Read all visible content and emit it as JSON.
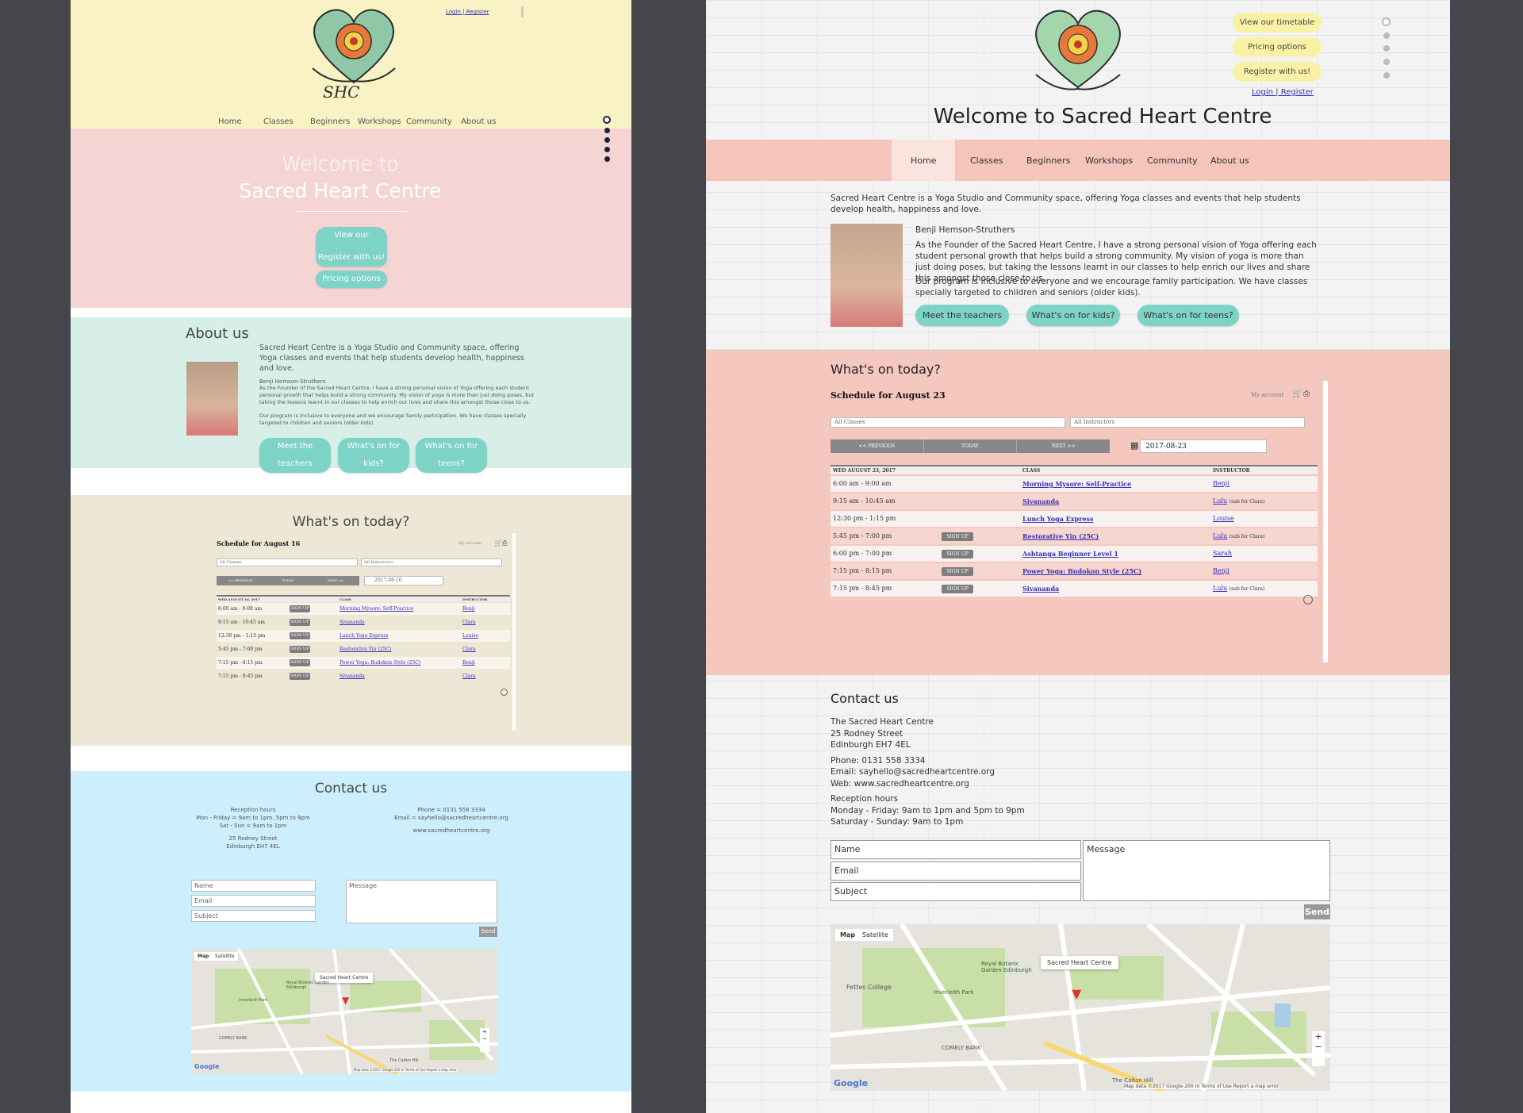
{
  "left": {
    "auth_link": "Login | Register",
    "logo_text": "SHC",
    "nav": [
      "Home",
      "Classes",
      "Beginners",
      "Workshops",
      "Community",
      "About us"
    ],
    "hero": {
      "title_line1": "Welcome to",
      "title_line2": "Sacred Heart Centre",
      "buttons": [
        "View our timetable",
        "Register with us!",
        "Pricing options"
      ]
    },
    "about": {
      "heading": "About us",
      "intro": "Sacred Heart Centre is a Yoga Studio and Community space, offering Yoga classes and events that help students develop health, happiness and love.",
      "name": "Benji Hemson-Struthers",
      "bio1": "As the Founder of the Sacred Heart Centre, I have a strong personal vision of Yoga offering each student personal growth that helps build a strong community. My vision of yoga is more than just doing poses, but taking the lessons learnt in our classes to help enrich our lives and share this amongst those close to us.",
      "bio2": "Our program is inclusive to everyone and we encourage family participation. We have classes specially targeted to children and seniors (older kids).",
      "buttons": [
        "Meet the teachers",
        "What's on for kids?",
        "What's on for teens?"
      ]
    },
    "today": {
      "heading": "What's on today?",
      "schedule_label": "Schedule for",
      "schedule_date": "August 16",
      "my_account": "My account",
      "filter_classes": "All Classes",
      "filter_instructors": "All Instructors",
      "prev": "<< PREVIOUS",
      "today": "TODAY",
      "next": "NEXT >>",
      "date_value": "2017-08-16",
      "col_day": "WED AUGUST 16, 2017",
      "col_class": "CLASS",
      "col_instructor": "INSTRUCTOR",
      "signup": "SIGN UP",
      "rows": [
        {
          "time": "6:00 am - 9:00 am",
          "class": "Morning Mysore: Self-Practice",
          "instructor": "Benji"
        },
        {
          "time": "9:15 am - 10:45 am",
          "class": "Sivananda",
          "instructor": "Clara"
        },
        {
          "time": "12:30 pm - 1:15 pm",
          "class": "Lunch Yoga Express",
          "instructor": "Louise"
        },
        {
          "time": "5:45 pm - 7:00 pm",
          "class": "Restorative Yin (25C)",
          "instructor": "Clara"
        },
        {
          "time": "7:15 pm - 8:15 pm",
          "class": "Power Yoga: Budokon Style (25C)",
          "instructor": "Benji"
        },
        {
          "time": "7:15 pm - 8:45 pm",
          "class": "Sivananda",
          "instructor": "Clara"
        }
      ]
    },
    "contact": {
      "heading": "Contact us",
      "hours_label": "Reception hours",
      "hours1": "Mon - Friday = 9am to 1pm, 5pm to 9pm",
      "hours2": "Sat - Sun = 9am to 1pm",
      "address1": "25 Rodney Street",
      "address2": "Edinburgh EH7 4EL",
      "phone": "Phone = 0131 558 3334",
      "email": "Email = sayhello@sacredheartcentre.org",
      "web": "www.sacredheartcentre.org",
      "name_ph": "Name",
      "email_ph": "Email",
      "subject_ph": "Subject",
      "message_ph": "Message",
      "send": "Send",
      "map_tab": "Map",
      "sat_tab": "Satellite",
      "marker": "Sacred Heart Centre",
      "map_place1": "Royal Botanic Garden Edinburgh",
      "map_place2": "COMELY BANK",
      "map_place3": "Inverleith Park",
      "map_place4": "The Calton Hill",
      "map_footer": "Map data ©2017 Google   200 m   Terms of Use   Report a map error",
      "google": "Google"
    }
  },
  "right": {
    "buttons": [
      "View our timetable",
      "Pricing options",
      "Register with us!"
    ],
    "auth_link": "Login | Register",
    "title": "Welcome to Sacred Heart Centre",
    "nav": [
      "Home",
      "Classes",
      "Beginners",
      "Workshops",
      "Community",
      "About us"
    ],
    "intro": "Sacred Heart Centre is a Yoga Studio and Community space, offering Yoga classes and events that help students develop health, happiness and love.",
    "name": "Benji Hemson-Struthers",
    "bio1": "As the Founder of the Sacred Heart Centre, I have a strong personal vision of Yoga offering each student personal growth that helps build a strong community. My vision of yoga is more than just doing poses, but taking the lessons learnt in our classes to help enrich our lives and share this amongst those close to us.",
    "bio2": "Our program is inclusive to everyone and we encourage family participation. We have classes specially targeted to children and seniors (older kids).",
    "about_buttons": [
      "Meet the teachers",
      "What's on for kids?",
      "What's on for teens?"
    ],
    "today": {
      "heading": "What's on today?",
      "schedule_label": "Schedule for",
      "schedule_date": "August 23",
      "my_account": "My account",
      "filter_classes": "All Classes",
      "filter_instructors": "All Instructors",
      "prev": "<< PREVIOUS",
      "today": "TODAY",
      "next": "NEXT >>",
      "date_value": "2017-08-23",
      "col_day": "WED AUGUST 23, 2017",
      "col_class": "CLASS",
      "col_instructor": "INSTRUCTOR",
      "signup": "SIGN UP",
      "rows": [
        {
          "time": "6:00 am - 9:00 am",
          "class": "Morning Mysore: Self-Practice",
          "instructor": "Benji",
          "sub": "",
          "signup": false
        },
        {
          "time": "9:15 am - 10:45 am",
          "class": "Sivananda",
          "instructor": "Lulu",
          "sub": "(sub for Clara)",
          "signup": false
        },
        {
          "time": "12:30 pm - 1:15 pm",
          "class": "Lunch Yoga Express",
          "instructor": "Louise",
          "sub": "",
          "signup": false
        },
        {
          "time": "5:45 pm - 7:00 pm",
          "class": "Restorative Yin (25C)",
          "instructor": "Lulu",
          "sub": "(sub for Clara)",
          "signup": true
        },
        {
          "time": "6:00 pm - 7:00 pm",
          "class": "Ashtanga Beginner Level 1",
          "instructor": "Sarah",
          "sub": "",
          "signup": true
        },
        {
          "time": "7:15 pm - 8:15 pm",
          "class": "Power Yoga: Budokon Style (25C)",
          "instructor": "Benji",
          "sub": "",
          "signup": true
        },
        {
          "time": "7:15 pm - 8:45 pm",
          "class": "Sivananda",
          "instructor": "Lulu",
          "sub": "(sub for Clara)",
          "signup": true
        }
      ]
    },
    "contact": {
      "heading": "Contact us",
      "line1": "The Sacred Heart Centre",
      "line2": "25 Rodney Street",
      "line3": "Edinburgh EH7 4EL",
      "phone": "Phone: 0131 558 3334",
      "email": "Email: sayhello@sacredheartcentre.org",
      "web": "Web: www.sacredheartcentre.org",
      "hours_label": "Reception hours",
      "hours1": "Monday - Friday: 9am to 1pm and 5pm to 9pm",
      "hours2": "Saturday - Sunday: 9am to 1pm",
      "name_ph": "Name",
      "email_ph": "Email",
      "subject_ph": "Subject",
      "message_ph": "Message",
      "send": "Send",
      "map_tab": "Map",
      "sat_tab": "Satellite",
      "marker": "Sacred Heart Centre",
      "map_place1": "Royal Botanic Garden Edinburgh",
      "map_place2": "Fettes College",
      "map_place3": "Inverleith Park",
      "map_place4": "COMELY BANK",
      "map_place5": "The Calton Hill",
      "map_footer": "Map data ©2017 Google   200 m   Terms of Use   Report a map error",
      "google": "Google"
    }
  },
  "colors": {
    "teal": "#7ed3c7",
    "yellow": "#f9f2a6",
    "pink": "#f5cac3",
    "mint": "#d6f0ea",
    "sand": "#ece6d3",
    "sky": "#cdeefc",
    "link": "#3a2fb8"
  }
}
